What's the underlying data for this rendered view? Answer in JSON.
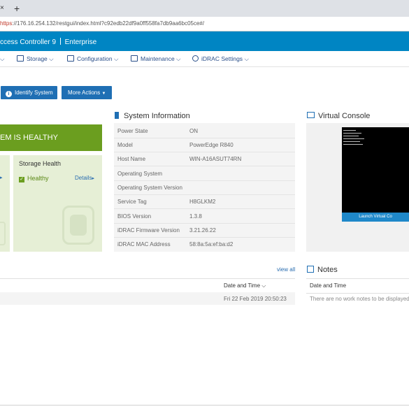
{
  "browser": {
    "tab_close": "×",
    "new_tab": "+",
    "url_https": "https",
    "url_rest": "://176.16.254.132/restgui/index.html?c92edb22df9a0ff558fa7db9aa6bc05ce#/"
  },
  "header": {
    "title": "ccess Controller 9",
    "edition": "Enterprise"
  },
  "nav": {
    "items": [
      {
        "label": "Storage"
      },
      {
        "label": "Configuration"
      },
      {
        "label": "Maintenance"
      },
      {
        "label": "iDRAC Settings"
      }
    ]
  },
  "actions": {
    "identify": "Identify System",
    "more": "More Actions"
  },
  "health": {
    "banner": "EM IS HEALTHY",
    "storage_title": "Storage Health",
    "storage_status": "Healthy",
    "details": "Details"
  },
  "system_info": {
    "title": "System Information",
    "rows": [
      {
        "label": "Power State",
        "value": "ON"
      },
      {
        "label": "Model",
        "value": "PowerEdge R840"
      },
      {
        "label": "Host Name",
        "value": "WIN-A16ASUT74RN"
      },
      {
        "label": "Operating System",
        "value": ""
      },
      {
        "label": "Operating System Version",
        "value": ""
      },
      {
        "label": "Service Tag",
        "value": "H8GLKM2"
      },
      {
        "label": "BIOS Version",
        "value": "1.3.8"
      },
      {
        "label": "iDRAC Firmware Version",
        "value": "3.21.26.22"
      },
      {
        "label": "iDRAC MAC Address",
        "value": "58:8a:5a:ef:ba:d2"
      }
    ]
  },
  "console": {
    "title": "Virtual Console",
    "launch": "Launch Virtual Co"
  },
  "logs": {
    "view_all": "view all",
    "col_date": "Date and Time",
    "row_date": "Fri 22 Feb 2019 20:50:23"
  },
  "notes": {
    "title": "Notes",
    "col_date": "Date and Time",
    "empty": "There are no work notes to be displayed."
  },
  "colors": {
    "brand_blue": "#0085c3",
    "healthy_green": "#6b9e1f"
  }
}
